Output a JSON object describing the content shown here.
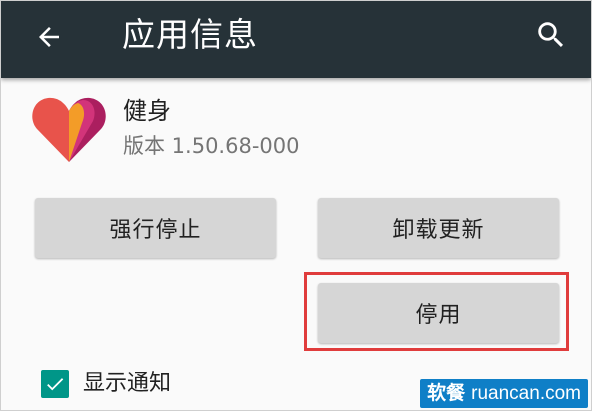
{
  "header": {
    "title": "应用信息",
    "back_icon": "arrow-left",
    "search_icon": "magnifier"
  },
  "app": {
    "name": "健身",
    "version": "版本 1.50.68-000",
    "icon": "heart-logo"
  },
  "buttons": {
    "force_stop": "强行停止",
    "uninstall_updates": "卸载更新",
    "disable": "停用"
  },
  "notifications": {
    "label": "显示通知",
    "checked": true
  },
  "watermark": {
    "cn": "软餐",
    "domain": "ruancan.com"
  },
  "colors": {
    "appbar": "#263238",
    "checkbox": "#009688",
    "highlight": "#e03c3c",
    "watermark": "#0f7fc7"
  }
}
